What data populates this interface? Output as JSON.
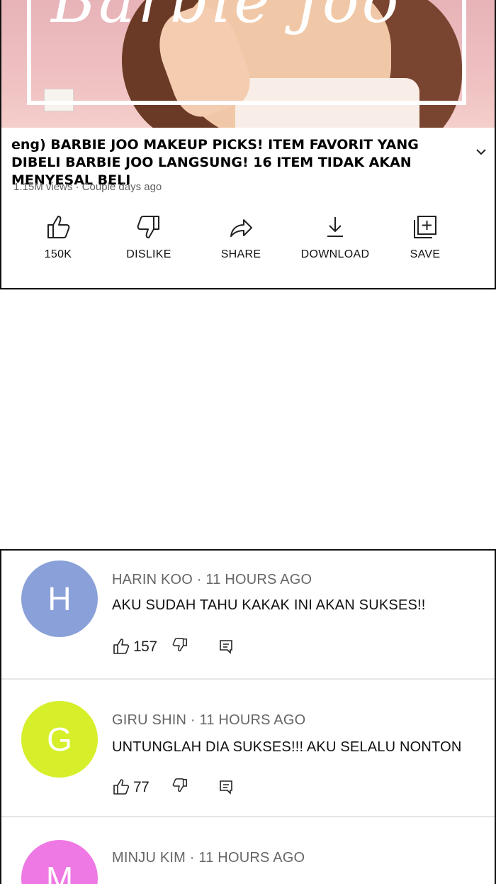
{
  "video": {
    "title": "eng) BARBIE JOO MAKEUP PICKS! ITEM FAVORIT YANG DIBELI BARBIE JOO LANGSUNG! 16 ITEM TIDAK AKAN MENYESAL BELI",
    "meta": "1.15M views · Couple days ago",
    "thumbnail_text": "Barbie Joo"
  },
  "actions": [
    {
      "icon": "thumbs-up-icon",
      "label": "150K"
    },
    {
      "icon": "thumbs-down-icon",
      "label": "DISLIKE"
    },
    {
      "icon": "share-icon",
      "label": "SHARE"
    },
    {
      "icon": "download-icon",
      "label": "DOWNLOAD"
    },
    {
      "icon": "save-playlist-icon",
      "label": "SAVE"
    }
  ],
  "comments": [
    {
      "initial": "H",
      "avatar_color": "#8aa0d9",
      "author": "HARIN KOO",
      "time": "11 HOURS AGO",
      "header": "HARIN KOO · 11 HOURS AGO",
      "text": "AKU SUDAH TAHU KAKAK INI AKAN SUKSES!!",
      "likes": "157"
    },
    {
      "initial": "G",
      "avatar_color": "#d6ef2a",
      "author": "GIRU SHIN",
      "time": "11 HOURS AGO",
      "header": "GIRU SHIN · 11 HOURS AGO",
      "text": "UNTUNGLAH DIA SUKSES!!! AKU SELALU NONTON",
      "likes": "77"
    },
    {
      "initial": "M",
      "avatar_color": "#ee78e4",
      "author": "MINJU KIM",
      "time": "11 HOURS AGO",
      "header": "MINJU KIM · 11 HOURS AGO",
      "text": "",
      "likes": ""
    }
  ]
}
